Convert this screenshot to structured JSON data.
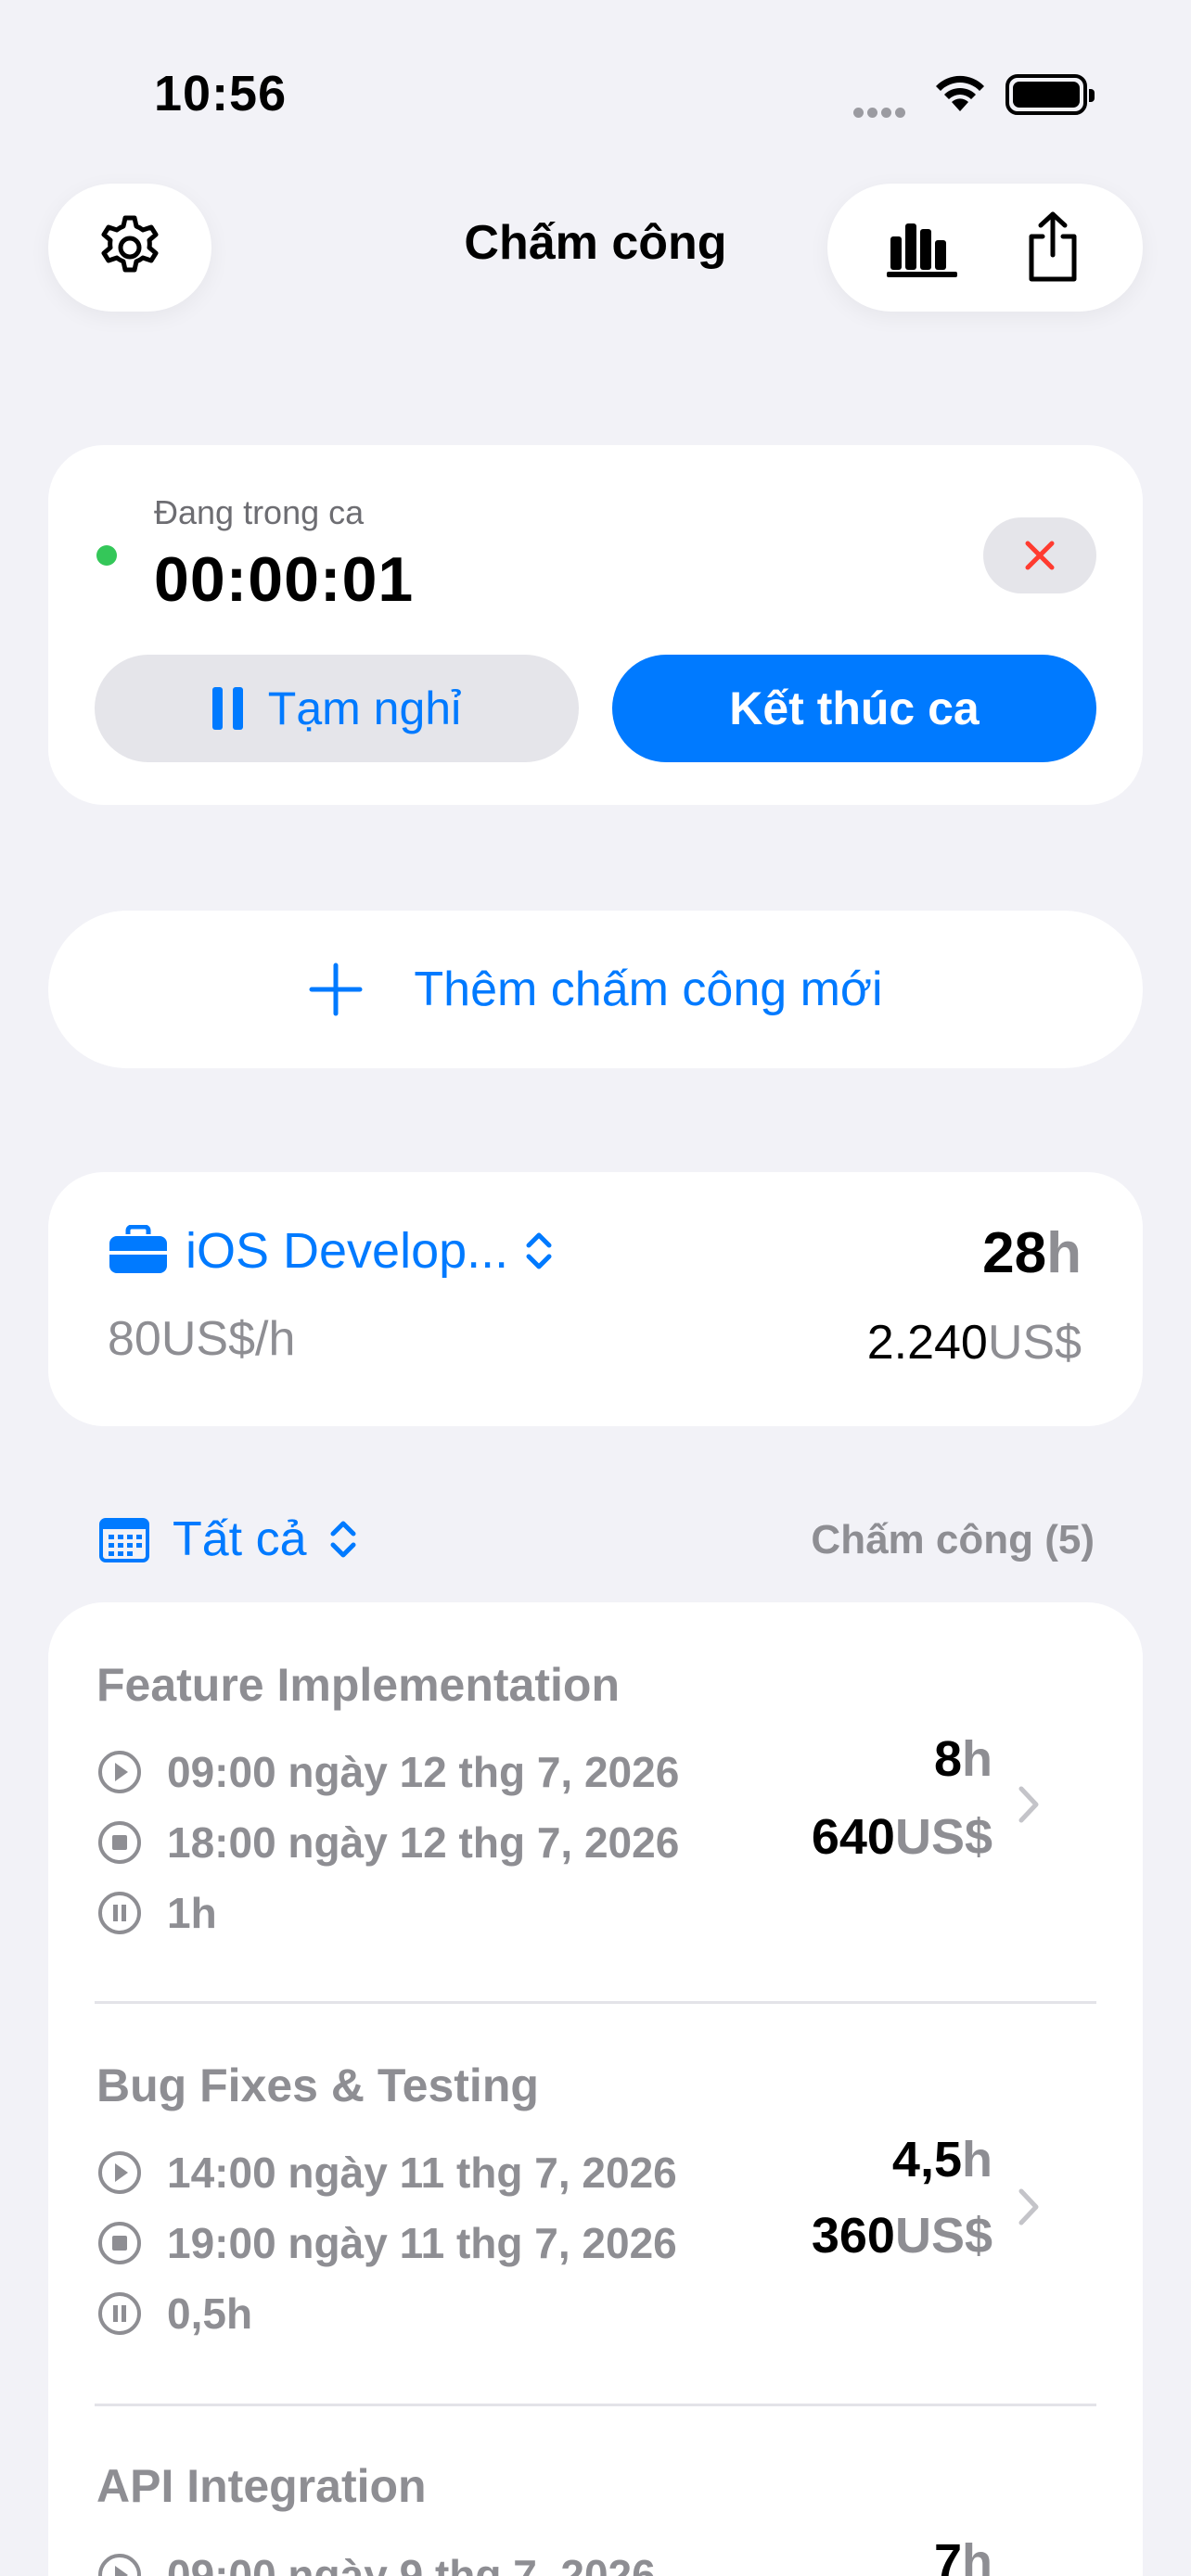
{
  "status_bar": {
    "time": "10:56"
  },
  "header": {
    "title": "Chấm công",
    "settings_icon": "gear-icon",
    "chart_icon": "bar-chart-icon",
    "share_icon": "share-icon"
  },
  "active_shift": {
    "status": "Đang trong ca",
    "timer": "00:00:01",
    "pause_label": "Tạm nghỉ",
    "end_label": "Kết thúc ca",
    "accent": "#007AFF",
    "indicator_color": "#34C759",
    "cancel_color": "#FF3B30"
  },
  "add_entry": {
    "label": "Thêm chấm công mới"
  },
  "job": {
    "name": "iOS Develop...",
    "rate": "80US$/h",
    "hours_value": "28",
    "hours_unit": "h",
    "earnings_value": "2.240",
    "earnings_unit": "US$"
  },
  "filter": {
    "label": "Tất cả",
    "entries_label": "Chấm công (5)"
  },
  "entries": [
    {
      "title": "Feature Implementation",
      "start": "09:00 ngày 12 thg 7, 2026",
      "end": "18:00 ngày 12 thg 7, 2026",
      "break": "1h",
      "hours_value": "8",
      "hours_unit": "h",
      "earn_value": "640",
      "earn_unit": "US$"
    },
    {
      "title": "Bug Fixes & Testing",
      "start": "14:00 ngày 11 thg 7, 2026",
      "end": "19:00 ngày 11 thg 7, 2026",
      "break": "0,5h",
      "hours_value": "4,5",
      "hours_unit": "h",
      "earn_value": "360",
      "earn_unit": "US$"
    },
    {
      "title": "API Integration",
      "start": "09:00 ngày 9 thg 7, 2026",
      "hours_value": "7",
      "hours_unit": "h"
    }
  ]
}
